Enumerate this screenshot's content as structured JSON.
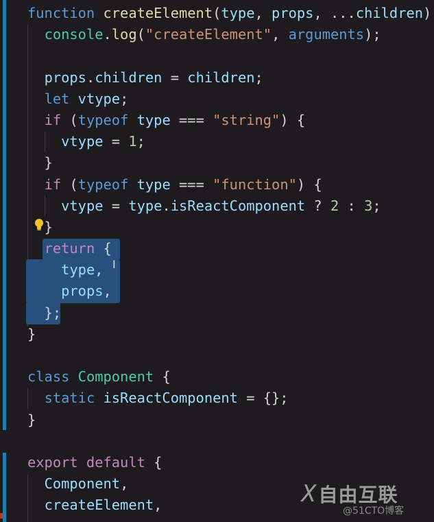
{
  "editor": {
    "lines": [
      [
        [
          "kw",
          "function "
        ],
        [
          "fn",
          "createElement"
        ],
        [
          "txt",
          "("
        ],
        [
          "var",
          "type"
        ],
        [
          "txt",
          ", "
        ],
        [
          "var",
          "props"
        ],
        [
          "txt",
          ", ..."
        ],
        [
          "var",
          "children"
        ],
        [
          "txt",
          ")"
        ]
      ],
      [
        [
          "txt",
          "  "
        ],
        [
          "obj",
          "console"
        ],
        [
          "txt",
          "."
        ],
        [
          "fn",
          "log"
        ],
        [
          "txt",
          "("
        ],
        [
          "str",
          "\"createElement\""
        ],
        [
          "txt",
          ", "
        ],
        [
          "kw",
          "arguments"
        ],
        [
          "txt",
          ");"
        ]
      ],
      [],
      [
        [
          "txt",
          "  "
        ],
        [
          "var",
          "props"
        ],
        [
          "txt",
          "."
        ],
        [
          "var",
          "children"
        ],
        [
          "txt",
          " = "
        ],
        [
          "var",
          "children"
        ],
        [
          "txt",
          ";"
        ]
      ],
      [
        [
          "txt",
          "  "
        ],
        [
          "kw",
          "let "
        ],
        [
          "var",
          "vtype"
        ],
        [
          "txt",
          ";"
        ]
      ],
      [
        [
          "txt",
          "  "
        ],
        [
          "ctl",
          "if"
        ],
        [
          "txt",
          " ("
        ],
        [
          "kw",
          "typeof "
        ],
        [
          "var",
          "type"
        ],
        [
          "txt",
          " === "
        ],
        [
          "str",
          "\"string\""
        ],
        [
          "txt",
          ") {"
        ]
      ],
      [
        [
          "txt",
          "    "
        ],
        [
          "var",
          "vtype"
        ],
        [
          "txt",
          " = "
        ],
        [
          "num",
          "1"
        ],
        [
          "txt",
          ";"
        ]
      ],
      [
        [
          "txt",
          "  }"
        ]
      ],
      [
        [
          "txt",
          "  "
        ],
        [
          "ctl",
          "if"
        ],
        [
          "txt",
          " ("
        ],
        [
          "kw",
          "typeof "
        ],
        [
          "var",
          "type"
        ],
        [
          "txt",
          " === "
        ],
        [
          "str",
          "\"function\""
        ],
        [
          "txt",
          ") {"
        ]
      ],
      [
        [
          "txt",
          "    "
        ],
        [
          "var",
          "vtype"
        ],
        [
          "txt",
          " = "
        ],
        [
          "var",
          "type"
        ],
        [
          "txt",
          "."
        ],
        [
          "var",
          "isReactComponent"
        ],
        [
          "txt",
          " ? "
        ],
        [
          "num",
          "2"
        ],
        [
          "txt",
          " : "
        ],
        [
          "num",
          "3"
        ],
        [
          "txt",
          ";"
        ]
      ],
      [
        [
          "txt",
          "  }"
        ]
      ],
      [
        [
          "txt",
          "  "
        ],
        [
          "ctl",
          "return"
        ],
        [
          "txt",
          " {"
        ]
      ],
      [
        [
          "txt",
          "    "
        ],
        [
          "var",
          "type"
        ],
        [
          "txt",
          ","
        ]
      ],
      [
        [
          "txt",
          "    "
        ],
        [
          "var",
          "props"
        ],
        [
          "txt",
          ","
        ]
      ],
      [
        [
          "txt",
          "  };"
        ]
      ],
      [
        [
          "txt",
          "}"
        ]
      ],
      [],
      [
        [
          "kw",
          "class "
        ],
        [
          "cls",
          "Component"
        ],
        [
          "txt",
          " {"
        ]
      ],
      [
        [
          "txt",
          "  "
        ],
        [
          "kw",
          "static "
        ],
        [
          "var",
          "isReactComponent"
        ],
        [
          "txt",
          " = {};"
        ]
      ],
      [
        [
          "txt",
          "}"
        ]
      ],
      [],
      [
        [
          "ctl",
          "export default"
        ],
        [
          "txt",
          " {"
        ]
      ],
      [
        [
          "txt",
          "  "
        ],
        [
          "var",
          "Component"
        ],
        [
          "txt",
          ","
        ]
      ],
      [
        [
          "txt",
          "  "
        ],
        [
          "var",
          "createElement"
        ],
        [
          "txt",
          ","
        ]
      ]
    ],
    "colors": {
      "background": "#1d1b1d",
      "selection": "#27507e",
      "gutter_bar": "#1b7fb0"
    },
    "icons": [
      "lightbulb-icon",
      "text-cursor-icon"
    ]
  },
  "watermark": {
    "logo": "自由互联",
    "mark": "X",
    "sub": "@51CTO博客"
  }
}
